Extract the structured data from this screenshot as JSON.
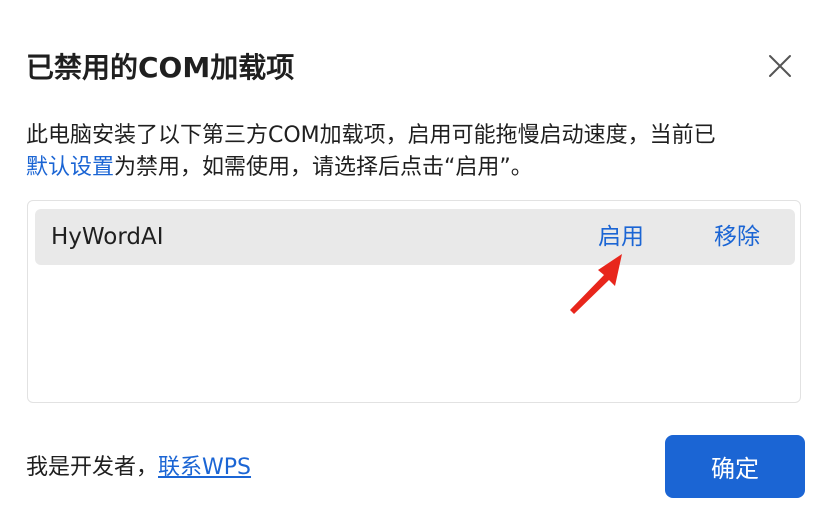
{
  "dialog": {
    "title": "已禁用的COM加载项",
    "close_icon": "close-icon"
  },
  "description": {
    "line1": "此电脑安装了以下第三方COM加载项，启用可能拖慢启动速度，当前已",
    "link": "默认设置",
    "line2_rest": "为禁用，如需使用，请选择后点击“启用”。"
  },
  "addins": [
    {
      "name": "HyWordAI",
      "enable_label": "启用",
      "remove_label": "移除"
    }
  ],
  "annotation": {
    "arrow_icon": "red-arrow-icon",
    "color": "#e8261c"
  },
  "footer": {
    "prefix": "我是开发者，",
    "link": "联系WPS",
    "confirm_label": "确定"
  },
  "colors": {
    "accent": "#1b65d4",
    "row_bg": "#e9e9e9"
  }
}
